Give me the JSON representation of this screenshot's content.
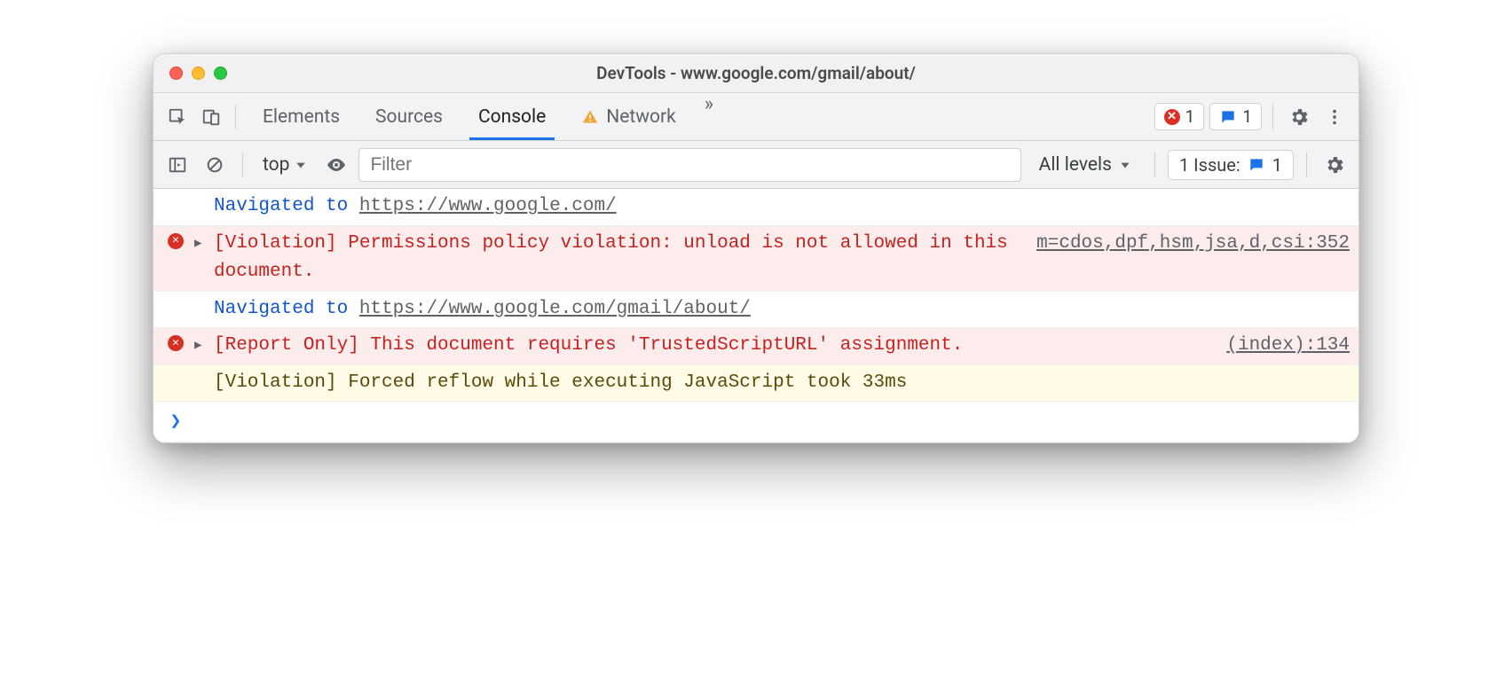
{
  "window": {
    "title": "DevTools - www.google.com/gmail/about/"
  },
  "tabs": {
    "elements": "Elements",
    "sources": "Sources",
    "console": "Console",
    "network": "Network"
  },
  "counters": {
    "errors": "1",
    "issues": "1"
  },
  "toolbar": {
    "context": "top",
    "filter_placeholder": "Filter",
    "levels": "All levels",
    "issues_label": "1 Issue:",
    "issues_count": "1"
  },
  "log": {
    "nav1_prefix": "Navigated to ",
    "nav1_url": "https://www.google.com/",
    "err1_msg": "[Violation] Permissions policy violation: unload is not allowed in this document.",
    "err1_src": "m=cdos,dpf,hsm,jsa,d,csi:352",
    "nav2_prefix": "Navigated to ",
    "nav2_url": "https://www.google.com/gmail/about/",
    "err2_msg": "[Report Only] This document requires 'TrustedScriptURL' assignment.",
    "err2_src": "(index):134",
    "warn1_msg": "[Violation] Forced reflow while executing JavaScript took 33ms"
  }
}
